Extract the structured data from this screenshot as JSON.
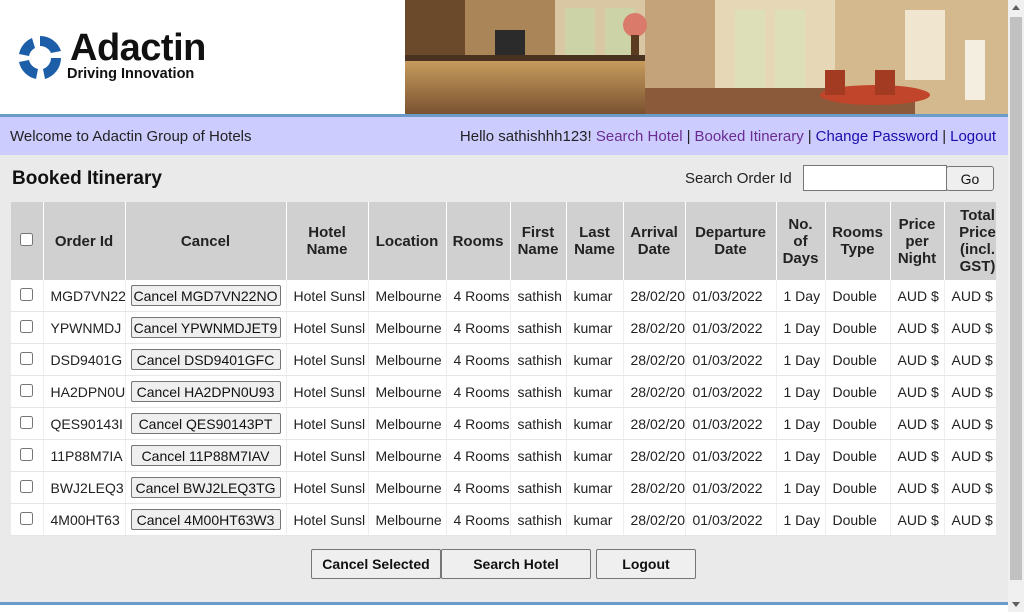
{
  "brand": {
    "name": "Adactin",
    "tagline": "Driving Innovation",
    "colors": {
      "mark": "#1c5fa8",
      "text": "#111111"
    }
  },
  "nav": {
    "welcome": "Welcome to Adactin Group of Hotels",
    "greeting": "Hello sathishhh123!",
    "links": [
      "Search Hotel",
      "Booked Itinerary",
      "Change Password",
      "Logout"
    ],
    "separator": "|",
    "background": "#ccccff"
  },
  "main": {
    "title": "Booked Itinerary",
    "search_label": "Search Order Id",
    "search_value": "",
    "go_label": "Go"
  },
  "table": {
    "headers": {
      "order_id": "Order Id",
      "cancel": "Cancel",
      "hotel_name": [
        "Hotel",
        "Name"
      ],
      "location": "Location",
      "rooms": "Rooms",
      "first_name": [
        "First",
        "Name"
      ],
      "last_name": [
        "Last",
        "Name"
      ],
      "arrival_date": [
        "Arrival",
        "Date"
      ],
      "departure_date": [
        "Departure",
        "Date"
      ],
      "no_of_days": [
        "No.",
        "of",
        "Days"
      ],
      "rooms_type": [
        "Rooms",
        "Type"
      ],
      "price_per_night": [
        "Price",
        "per",
        "Night"
      ],
      "total_price": [
        "Total",
        "Price",
        "(incl.",
        "GST)"
      ]
    },
    "rows": [
      {
        "order_id": "MGD7VN22",
        "cancel": "Cancel MGD7VN22NO",
        "hotel": "Hotel Sunsl",
        "location": "Melbourne",
        "rooms": "4 Rooms",
        "first": "sathish",
        "last": "kumar",
        "arrival": "28/02/20",
        "departure": "01/03/2022",
        "days": "1 Day",
        "type": "Double",
        "price": "AUD $",
        "total": "AUD $"
      },
      {
        "order_id": "YPWNMDJ",
        "cancel": "Cancel YPWNMDJET9",
        "hotel": "Hotel Sunsl",
        "location": "Melbourne",
        "rooms": "4 Rooms",
        "first": "sathish",
        "last": "kumar",
        "arrival": "28/02/20",
        "departure": "01/03/2022",
        "days": "1 Day",
        "type": "Double",
        "price": "AUD $",
        "total": "AUD $"
      },
      {
        "order_id": "DSD9401G",
        "cancel": "Cancel DSD9401GFC",
        "hotel": "Hotel Sunsl",
        "location": "Melbourne",
        "rooms": "4 Rooms",
        "first": "sathish",
        "last": "kumar",
        "arrival": "28/02/20",
        "departure": "01/03/2022",
        "days": "1 Day",
        "type": "Double",
        "price": "AUD $",
        "total": "AUD $"
      },
      {
        "order_id": "HA2DPN0U",
        "cancel": "Cancel HA2DPN0U93",
        "hotel": "Hotel Sunsl",
        "location": "Melbourne",
        "rooms": "4 Rooms",
        "first": "sathish",
        "last": "kumar",
        "arrival": "28/02/20",
        "departure": "01/03/2022",
        "days": "1 Day",
        "type": "Double",
        "price": "AUD $",
        "total": "AUD $"
      },
      {
        "order_id": "QES90143I",
        "cancel": "Cancel QES90143PT",
        "hotel": "Hotel Sunsl",
        "location": "Melbourne",
        "rooms": "4 Rooms",
        "first": "sathish",
        "last": "kumar",
        "arrival": "28/02/20",
        "departure": "01/03/2022",
        "days": "1 Day",
        "type": "Double",
        "price": "AUD $",
        "total": "AUD $"
      },
      {
        "order_id": "11P88M7IA",
        "cancel": "Cancel 11P88M7IAV",
        "hotel": "Hotel Sunsl",
        "location": "Melbourne",
        "rooms": "4 Rooms",
        "first": "sathish",
        "last": "kumar",
        "arrival": "28/02/20",
        "departure": "01/03/2022",
        "days": "1 Day",
        "type": "Double",
        "price": "AUD $",
        "total": "AUD $"
      },
      {
        "order_id": "BWJ2LEQ3",
        "cancel": "Cancel BWJ2LEQ3TG",
        "hotel": "Hotel Sunsl",
        "location": "Melbourne",
        "rooms": "4 Rooms",
        "first": "sathish",
        "last": "kumar",
        "arrival": "28/02/20",
        "departure": "01/03/2022",
        "days": "1 Day",
        "type": "Double",
        "price": "AUD $",
        "total": "AUD $"
      },
      {
        "order_id": "4M00HT63",
        "cancel": "Cancel 4M00HT63W3",
        "hotel": "Hotel Sunsl",
        "location": "Melbourne",
        "rooms": "4 Rooms",
        "first": "sathish",
        "last": "kumar",
        "arrival": "28/02/20",
        "departure": "01/03/2022",
        "days": "1 Day",
        "type": "Double",
        "price": "AUD $",
        "total": "AUD $"
      }
    ]
  },
  "actions": {
    "cancel_selected": "Cancel Selected",
    "search_hotel": "Search Hotel",
    "logout": "Logout"
  },
  "icons": {
    "logo": "adactin-logo-icon",
    "scroll_up": "chevron-up-icon",
    "scroll_down": "chevron-down-icon"
  },
  "colors": {
    "accent_rule": "#6b9bc8",
    "content_bg": "#eaeaea",
    "header_cell_bg": "#d0d0d0",
    "link_visited": "#6a2c91",
    "link": "#1a0dab"
  }
}
